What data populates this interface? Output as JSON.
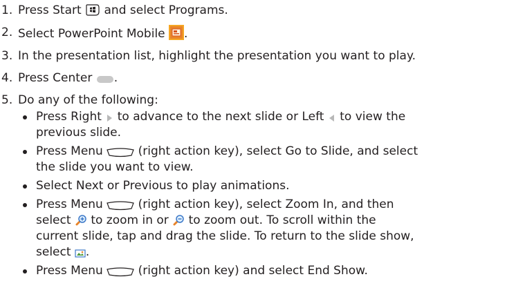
{
  "steps": [
    {
      "num": "1.",
      "a": "Press Start",
      "b": "and select Programs.",
      "icon": "windows-start-key-icon"
    },
    {
      "num": "2.",
      "a": "Select PowerPoint Mobile",
      "b": ".",
      "icon": "powerpoint-mobile-icon"
    },
    {
      "num": "3.",
      "text": "In the presentation list, highlight the presentation you want to play."
    },
    {
      "num": "4.",
      "a": "Press Center",
      "b": ".",
      "icon": "center-key-icon"
    },
    {
      "num": "5.",
      "text": "Do any of the following:"
    }
  ],
  "bullets": [
    {
      "a": "Press Right",
      "b": "to advance to the next slide or Left",
      "c": "to view the",
      "d": "previous slide.",
      "icons": [
        "right-arrow-icon",
        "left-arrow-icon"
      ]
    },
    {
      "a": "Press Menu",
      "b": "(right action key), select Go to Slide, and select",
      "c": "the slide you want to view.",
      "icons": [
        "right-soft-key-icon"
      ]
    },
    {
      "text": "Select Next or Previous to play animations."
    },
    {
      "a": "Press Menu",
      "b": "(right action key), select Zoom In, and then",
      "c": "select",
      "d": "to zoom in or",
      "e": "to zoom out. To scroll within the",
      "f": "current slide, tap and drag the slide. To return to the slide show,",
      "g": "select",
      "h": ".",
      "icons": [
        "right-soft-key-icon",
        "zoom-in-icon",
        "zoom-out-icon",
        "slide-show-icon"
      ]
    },
    {
      "a": "Press Menu",
      "b": "(right action key) and select End Show.",
      "icons": [
        "right-soft-key-icon"
      ]
    }
  ],
  "colors": {
    "text": "#231f20",
    "icon_gray": "#b8b8b8",
    "ppt_orange": "#f5a623",
    "ppt_red": "#d9531e"
  }
}
